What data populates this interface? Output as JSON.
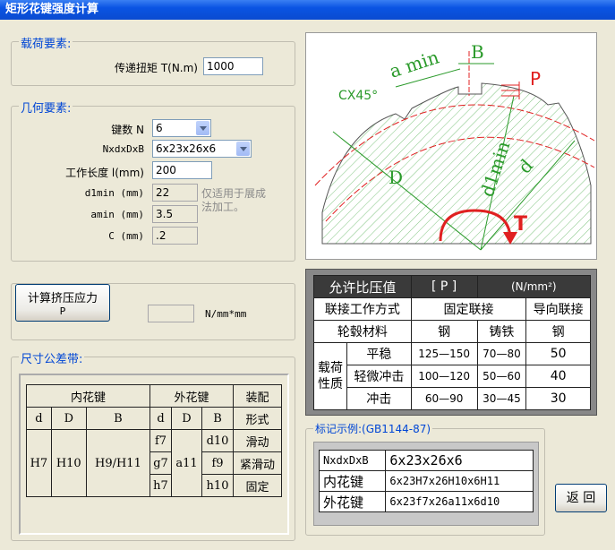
{
  "window": {
    "title": "矩形花键强度计算"
  },
  "load": {
    "legend": "载荷要素:",
    "torque_label": "传递扭矩 T(N.m)",
    "torque_value": "1000"
  },
  "geometry": {
    "legend": "几何要素:",
    "keys_label": "键数 N",
    "keys_value": "6",
    "spec_label": "NxdxDxB",
    "spec_value": "6x23x26x6",
    "length_label": "工作长度 l(mm)",
    "length_value": "200",
    "d1min_label": "d1min (mm)",
    "d1min_value": "22",
    "amin_label": "amin (mm)",
    "amin_value": "3.5",
    "c_label": "C (mm)",
    "c_value": ".2",
    "note": "仅适用于展成法加工。"
  },
  "calc": {
    "button_line1": "计算挤压应力",
    "button_line2": "P",
    "result_value": "",
    "unit": "N/mm*mm"
  },
  "tolerance": {
    "legend": "尺寸公差带:",
    "inner": "内花键",
    "outer": "外花键",
    "assembly": "装配",
    "form": "形式",
    "d": "d",
    "D": "D",
    "B": "B",
    "inner_d": "H7",
    "inner_D": "H10",
    "inner_B": "H9/H11",
    "outer_D": "a11",
    "rows": [
      {
        "od": "f7",
        "oB": "d10",
        "form": "滑动"
      },
      {
        "od": "g7",
        "oB": "f9",
        "form": "紧滑动"
      },
      {
        "od": "h7",
        "oB": "h10",
        "form": "固定"
      }
    ]
  },
  "diagram": {
    "a_min": "a min",
    "B": "B",
    "P": "P",
    "chamfer": "CX45°",
    "D": "D",
    "d1min": "d1min",
    "d": "d",
    "T": "T"
  },
  "pressure_table": {
    "title": "允许比压值",
    "symbol": "[ P ]",
    "unit": "(N/mm²)",
    "method_label": "联接工作方式",
    "fixed": "固定联接",
    "guide": "导向联接",
    "material_label": "轮毂材料",
    "steel": "钢",
    "cast": "铸铁",
    "steel2": "钢",
    "nature_label": "载荷性质",
    "rows": [
      {
        "name": "平稳",
        "steel": "125—150",
        "cast": "70—80",
        "guide": "50"
      },
      {
        "name": "轻微冲击",
        "steel": "100—120",
        "cast": "50—60",
        "guide": "40"
      },
      {
        "name": "冲击",
        "steel": "60—90",
        "cast": "30—45",
        "guide": "30"
      }
    ]
  },
  "marking": {
    "legend": "标记示例:(GB1144-87)",
    "rows": [
      {
        "label": "NxdxDxB",
        "value": "6x23x26x6"
      },
      {
        "label": "内花键",
        "value": "6x23H7x26H10x6H11"
      },
      {
        "label": "外花键",
        "value": "6x23f7x26a11x6d10"
      }
    ]
  },
  "back_button": "返 回",
  "colors": {
    "title_bar": "#0a54e3",
    "legend_text": "#0046d5",
    "diagram_red": "#e02020",
    "diagram_green": "#2a9a2a",
    "dark_header": "#3a3a3a"
  }
}
